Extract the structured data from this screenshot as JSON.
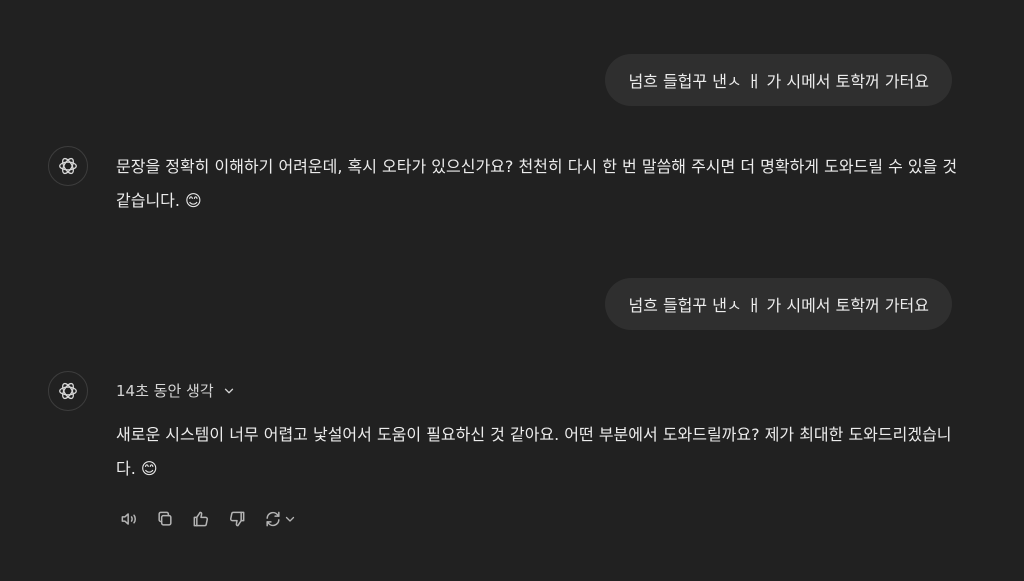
{
  "conversation": {
    "user_message_1": "넘흐 들헙꾸 낸ㅅ ㅐ 가 시메서 토학꺼 가터요",
    "assistant_message_1": "문장을 정확히 이해하기 어려운데, 혹시 오타가 있으신가요? 천천히 다시 한 번 말씀해 주시면 더 명확하게 도와드릴 수 있을 것 같습니다. 😊",
    "user_message_2": "넘흐 들헙꾸 낸ㅅ ㅐ 가 시메서 토학꺼 가터요",
    "thought_label": "14초 동안 생각",
    "assistant_message_2": "새로운 시스템이 너무 어렵고 낯설어서 도움이 필요하신 것 같아요. 어떤 부분에서 도와드릴까요? 제가 최대한 도와드리겠습니다. 😊"
  },
  "icons": {
    "assistant_avatar": "openai-logo-icon",
    "thought_toggle": "chevron-down-icon",
    "actions": [
      "speaker-icon",
      "copy-icon",
      "thumbs-up-icon",
      "thumbs-down-icon",
      "regenerate-icon",
      "chevron-down-icon"
    ]
  },
  "colors": {
    "background": "#212121",
    "user_bubble": "#2f2f2f",
    "text": "#ececec",
    "icon": "#b4b4b4"
  }
}
